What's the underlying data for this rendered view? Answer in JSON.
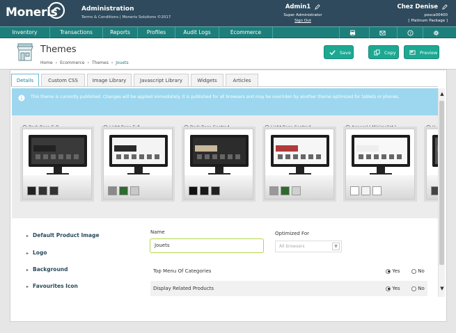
{
  "app": {
    "logo": "Moneris",
    "title": "Administration",
    "subtitle": "Terms & Conditions | Moneris Solutions ©2017"
  },
  "user": {
    "name": "Admin1",
    "role": "Super Administrator",
    "signout": "Sign Out"
  },
  "store": {
    "name": "Chez Denise",
    "id": "posca00400",
    "package": "[ Platinum Package ]"
  },
  "nav": {
    "items": [
      "Inventory",
      "Transactions",
      "Reports",
      "Profiles",
      "Audit Logs",
      "Ecommerce"
    ]
  },
  "page": {
    "title": "Themes",
    "breadcrumb": [
      "Home",
      "Ecommerce",
      "Themes",
      "Jouets"
    ]
  },
  "actions": {
    "save": "Save",
    "copy": "Copy",
    "preview": "Preview"
  },
  "tabs": [
    "Details",
    "Custom CSS",
    "Image Library",
    "Javascript Library",
    "Widgets",
    "Articles"
  ],
  "notice": "This theme is currently published. Changes will be applied immediately. It is published for all browsers and may be overriden by another theme optimized for tablets or phones.",
  "themes": [
    {
      "label": "Dark Base Full",
      "selected": false,
      "screen": "#3a3a3a",
      "banner": "#222222",
      "swatches": [
        "#222222",
        "#333333",
        "#333333"
      ]
    },
    {
      "label": "Light Base Full",
      "selected": false,
      "screen": "#f4f4f4",
      "banner": "#2a2a2a",
      "swatches": [
        "#8a8a8a",
        "#2e6b2e",
        "#c8c8c8"
      ]
    },
    {
      "label": "Dark Base Centred",
      "selected": false,
      "screen": "#2c2c2c",
      "banner": "#c8b89a",
      "swatches": [
        "#111111",
        "#1a1a1a",
        "#222222"
      ]
    },
    {
      "label": "Light Base Centred",
      "selected": true,
      "screen": "#f6f6f6",
      "banner": "#b33a3a",
      "swatches": [
        "#999999",
        "#2e6b2e",
        "#d0d0d0"
      ]
    },
    {
      "label": "Apparel ( Minimalist )",
      "selected": false,
      "screen": "#f8f8f8",
      "banner": "#eeeeee",
      "swatches": [
        "#ffffff",
        "#f3f3f3",
        "#ffffff"
      ]
    },
    {
      "label": "H",
      "selected": false,
      "screen": "#555555",
      "banner": "#b06020",
      "swatches": [
        "#444444"
      ]
    }
  ],
  "properties": [
    "Default Product Image",
    "Logo",
    "Background",
    "Favourites Icon"
  ],
  "form": {
    "name_label": "Name",
    "name_value": "Jouets",
    "optimized_label": "Optimized For",
    "optimized_value": "All browsers"
  },
  "settings": [
    {
      "label": "Top Menu Of Categories",
      "yes": "Yes",
      "no": "No",
      "value": "Yes"
    },
    {
      "label": "Display Related Products",
      "yes": "Yes",
      "no": "No",
      "value": "Yes"
    }
  ],
  "colors": {
    "topbar": "#2e4a5c",
    "nav": "#1d7f7b",
    "accent": "#1da892",
    "notice": "#9dd7ef"
  },
  "icons": [
    "pencil-icon",
    "print-icon",
    "mail-icon",
    "help-icon",
    "settings-icon",
    "save-icon",
    "copy-icon",
    "preview-icon",
    "info-icon",
    "store-icon"
  ]
}
